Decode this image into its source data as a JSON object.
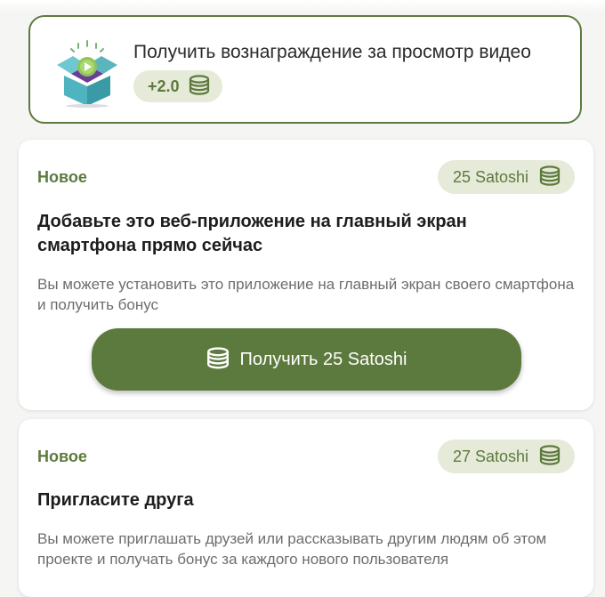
{
  "video_reward": {
    "title": "Получить вознаграждение за просмотр видео",
    "amount": "+2.0",
    "icon": "video-box-icon",
    "coin_icon": "coins-icon"
  },
  "tasks": [
    {
      "status": "Новое",
      "reward": "25 Satoshi",
      "title": "Добавьте это веб-приложение на главный экран смартфона прямо сейчас",
      "description": "Вы можете установить это приложение на главный экран своего смартфона и получить бонус",
      "button_label": "Получить 25 Satoshi"
    },
    {
      "status": "Новое",
      "reward": "27 Satoshi",
      "title": "Пригласите друга",
      "description": "Вы можете приглашать друзей или рассказывать другим людям об этом проекте и получать бонус за каждого нового пользователя"
    }
  ],
  "colors": {
    "accent": "#5d7a3e",
    "pill_background": "#e6ead9",
    "text_primary": "#1d1d1d",
    "text_secondary": "#6d6d6d"
  }
}
